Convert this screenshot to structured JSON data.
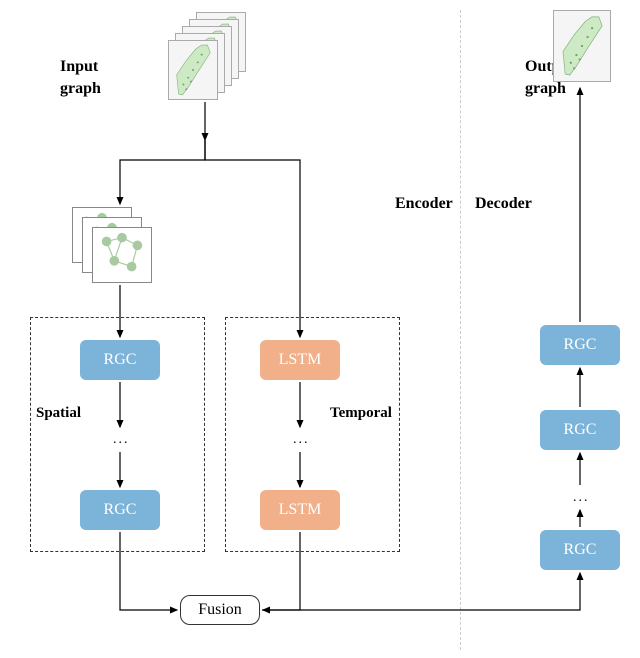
{
  "labels": {
    "input_graph_l1": "Input",
    "input_graph_l2": "graph",
    "output_graph_l1": "Output",
    "output_graph_l2": "graph",
    "encoder": "Encoder",
    "decoder": "Decoder",
    "spatial": "Spatial",
    "temporal": "Temporal"
  },
  "blocks": {
    "rgc": "RGC",
    "lstm": "LSTM",
    "fusion": "Fusion"
  },
  "ellipsis": "..."
}
